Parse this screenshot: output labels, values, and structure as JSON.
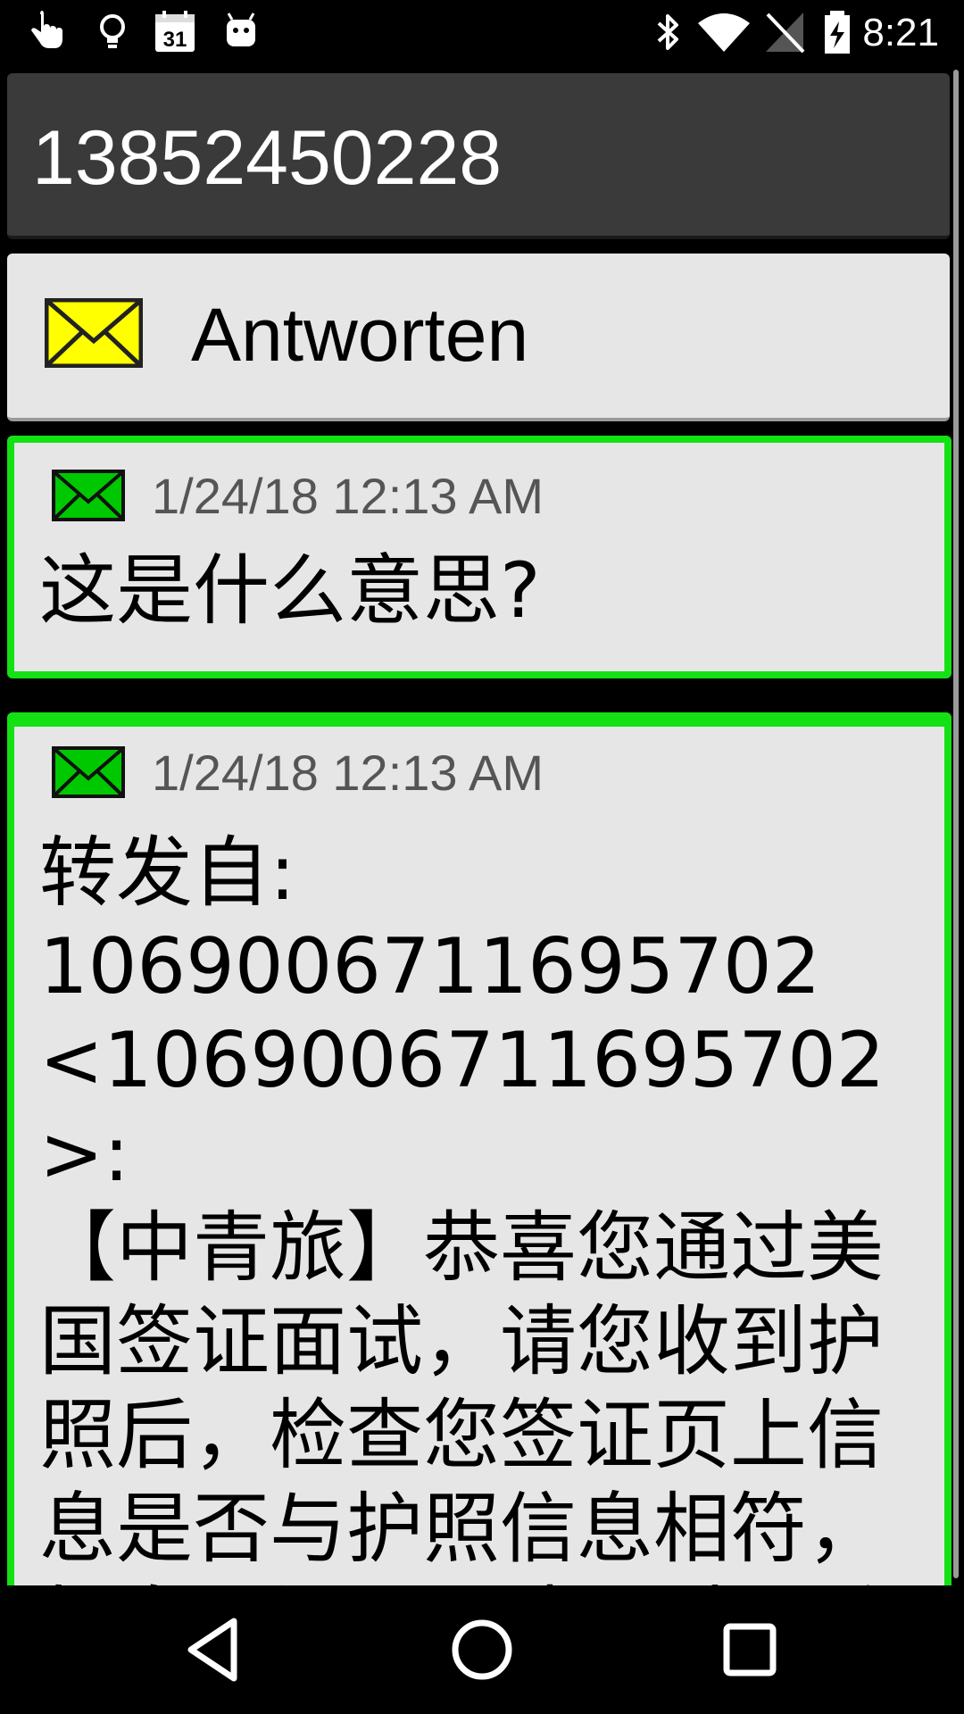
{
  "status_bar": {
    "time": "8:21",
    "left_icons": [
      "touch-icon",
      "lightbulb-icon",
      "calendar-icon",
      "android-icon"
    ],
    "calendar_day": "31",
    "right_icons": [
      "bluetooth-icon",
      "wifi-icon",
      "no-signal-icon",
      "battery-charging-icon"
    ]
  },
  "header": {
    "phone_number": "13852450228"
  },
  "reply": {
    "label": "Antworten",
    "icon": "envelope-yellow-icon"
  },
  "messages": [
    {
      "icon": "envelope-green-icon",
      "timestamp": "1/24/18 12:13 AM",
      "body": "这是什么意思?"
    },
    {
      "icon": "envelope-green-icon",
      "timestamp": "1/24/18 12:13 AM",
      "body": "转发自:\n1069006711695702\n<1069006711695702>:\n【中青旅】恭喜您通过美国签证面试，请您收到护照后，检查您签证页上信息是否与护照信息相符，如发现问题，请及时联系"
    }
  ],
  "nav_bar": {
    "items": [
      "back-icon",
      "home-icon",
      "recents-icon"
    ]
  },
  "colors": {
    "message_border": "#14e114",
    "header_bg": "#3a3a3a",
    "card_bg": "#e6e6e6",
    "reply_envelope": "#ffff00",
    "message_envelope": "#00c800"
  }
}
